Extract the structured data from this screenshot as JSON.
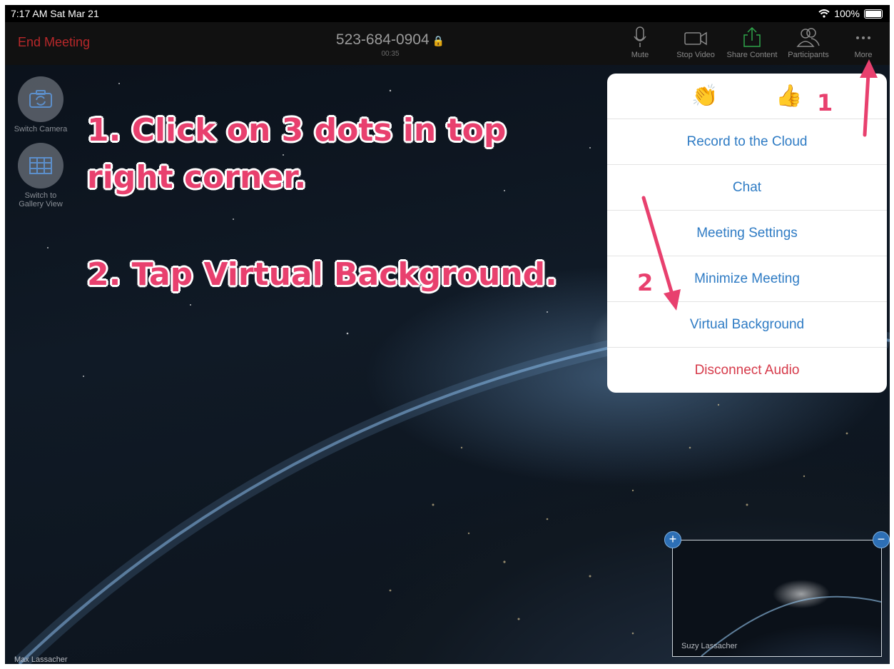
{
  "status_bar": {
    "time": "7:17 AM  Sat Mar 21",
    "battery": "100%"
  },
  "top_bar": {
    "end_meeting": "End Meeting",
    "meeting_id": "523-684-0904",
    "timer": "00:35",
    "buttons": {
      "mute": "Mute",
      "stop_video": "Stop Video",
      "share_content": "Share Content",
      "participants": "Participants",
      "more": "More"
    }
  },
  "left_controls": {
    "switch_camera": "Switch Camera",
    "gallery_line1": "Switch to",
    "gallery_line2": "Gallery View"
  },
  "overlay": {
    "step1": "1.  Click on 3 dots in top right corner.",
    "step2": "2.  Tap Virtual Background.",
    "marker1": "1",
    "marker2": "2"
  },
  "menu": {
    "reactions": [
      "👏",
      "👍"
    ],
    "items": [
      "Record to the Cloud",
      "Chat",
      "Meeting Settings",
      "Minimize Meeting",
      "Virtual Background",
      "Disconnect Audio"
    ]
  },
  "video": {
    "main_participant": "Max Lassacher",
    "thumbnail_participant": "Suzy Lassacher"
  },
  "colors": {
    "annotation": "#e8406e",
    "menu_link": "#2e7bc4",
    "danger": "#d63a4a",
    "end_meeting": "#b8282a"
  }
}
